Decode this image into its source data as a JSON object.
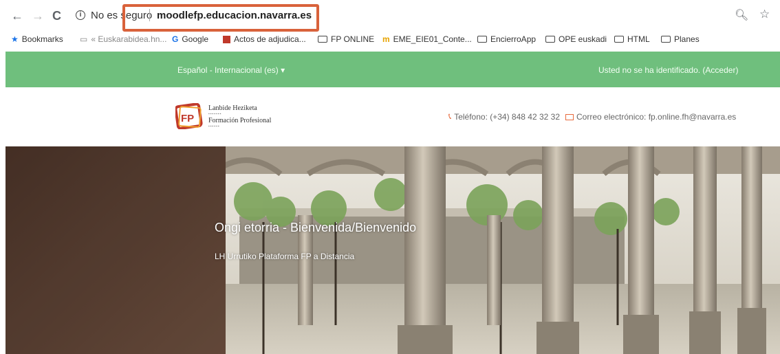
{
  "browser": {
    "back_icon": "arrow-left-icon",
    "forward_icon": "arrow-right-icon",
    "reload_icon": "reload-icon",
    "security_label": "No es seguro",
    "url": "moodlefp.educacion.navarra.es",
    "highlight_color": "#d9623b"
  },
  "bookmarks": [
    {
      "label": "Bookmarks",
      "icon": "star-icon"
    },
    {
      "label": "« Euskarabidea.hn...",
      "icon": "page-icon"
    },
    {
      "label": "Google",
      "icon": "google-icon"
    },
    {
      "label": "Actos de adjudica...",
      "icon": "red-icon"
    },
    {
      "label": "FP ONLINE",
      "icon": "folder-icon"
    },
    {
      "label": "EME_EIE01_Conte...",
      "icon": "moodle-icon"
    },
    {
      "label": "EncierroApp",
      "icon": "folder-icon"
    },
    {
      "label": "OPE euskadi",
      "icon": "folder-icon"
    },
    {
      "label": "HTML",
      "icon": "folder-icon"
    },
    {
      "label": "Planes",
      "icon": "folder-icon"
    }
  ],
  "header": {
    "language": "Español - Internacional (es) ▾",
    "login_status": "Usted no se ha identificado. (Acceder)",
    "bar_color": "#6fbf7d"
  },
  "brand": {
    "logo_mark": "FP",
    "line1": "Lanbide Heziketa",
    "line2": "Formación Profesional",
    "phone": "Teléfono: (+34) 848 42 32 32",
    "email": "Correo electrónico: fp.online.fh@navarra.es",
    "accent_color": "#e86a3c"
  },
  "hero": {
    "title": "Ongi etorria - Bienvenida/Bienvenido",
    "subtitle": "LH Urrutiko Plataforma FP a Distancia"
  }
}
